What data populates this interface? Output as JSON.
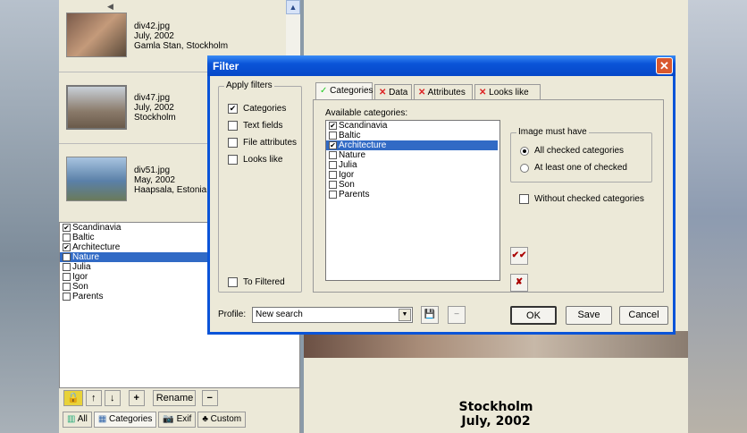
{
  "thumbnails": [
    {
      "file": "div42.jpg",
      "date": "July, 2002",
      "place": "Gamla Stan, Stockholm"
    },
    {
      "file": "div47.jpg",
      "date": "July, 2002",
      "place": "Stockholm"
    },
    {
      "file": "div51.jpg",
      "date": "May, 2002",
      "place": "Haapsala, Estonia"
    }
  ],
  "left_categories": [
    {
      "label": "Scandinavia",
      "checked": true,
      "selected": false
    },
    {
      "label": "Baltic",
      "checked": false,
      "selected": false
    },
    {
      "label": "Architecture",
      "checked": true,
      "selected": false
    },
    {
      "label": "Nature",
      "checked": false,
      "selected": true
    },
    {
      "label": "Julia",
      "checked": false,
      "selected": false
    },
    {
      "label": "Igor",
      "checked": false,
      "selected": false
    },
    {
      "label": "Son",
      "checked": false,
      "selected": false
    },
    {
      "label": "Parents",
      "checked": false,
      "selected": false
    }
  ],
  "toolbar": {
    "rename": "Rename",
    "plus": "+",
    "minus": "−",
    "up": "↑",
    "down": "↓"
  },
  "bottom_tabs": [
    "All",
    "Categories",
    "Exif",
    "Custom"
  ],
  "preview": {
    "title": "Stockholm",
    "date": "July, 2002"
  },
  "dialog": {
    "title": "Filter",
    "apply_filters": {
      "label": "Apply filters",
      "items": [
        {
          "label": "Categories",
          "checked": true
        },
        {
          "label": "Text fields",
          "checked": false
        },
        {
          "label": "File attributes",
          "checked": false
        },
        {
          "label": "Looks like",
          "checked": false
        }
      ],
      "to_filtered": "To Filtered"
    },
    "tabs": [
      {
        "label": "Categories",
        "status": "ok"
      },
      {
        "label": "Data",
        "status": "off"
      },
      {
        "label": "Attributes",
        "status": "off"
      },
      {
        "label": "Looks like",
        "status": "off"
      }
    ],
    "available_label": "Available categories:",
    "categories": [
      {
        "label": "Scandinavia",
        "checked": true,
        "selected": false
      },
      {
        "label": "Baltic",
        "checked": false,
        "selected": false
      },
      {
        "label": "Architecture",
        "checked": true,
        "selected": true
      },
      {
        "label": "Nature",
        "checked": false,
        "selected": false
      },
      {
        "label": "Julia",
        "checked": false,
        "selected": false
      },
      {
        "label": "Igor",
        "checked": false,
        "selected": false
      },
      {
        "label": "Son",
        "checked": false,
        "selected": false
      },
      {
        "label": "Parents",
        "checked": false,
        "selected": false
      }
    ],
    "must_have": {
      "label": "Image must have",
      "options": [
        "All checked categories",
        "At least one of checked"
      ],
      "selected": 0
    },
    "without_checked": "Without checked categories",
    "profile_label": "Profile:",
    "profile_value": "New search",
    "ok": "OK",
    "save": "Save",
    "cancel": "Cancel"
  },
  "colors": {
    "titlebar": "#0a54d8",
    "selection": "#316ac5"
  }
}
